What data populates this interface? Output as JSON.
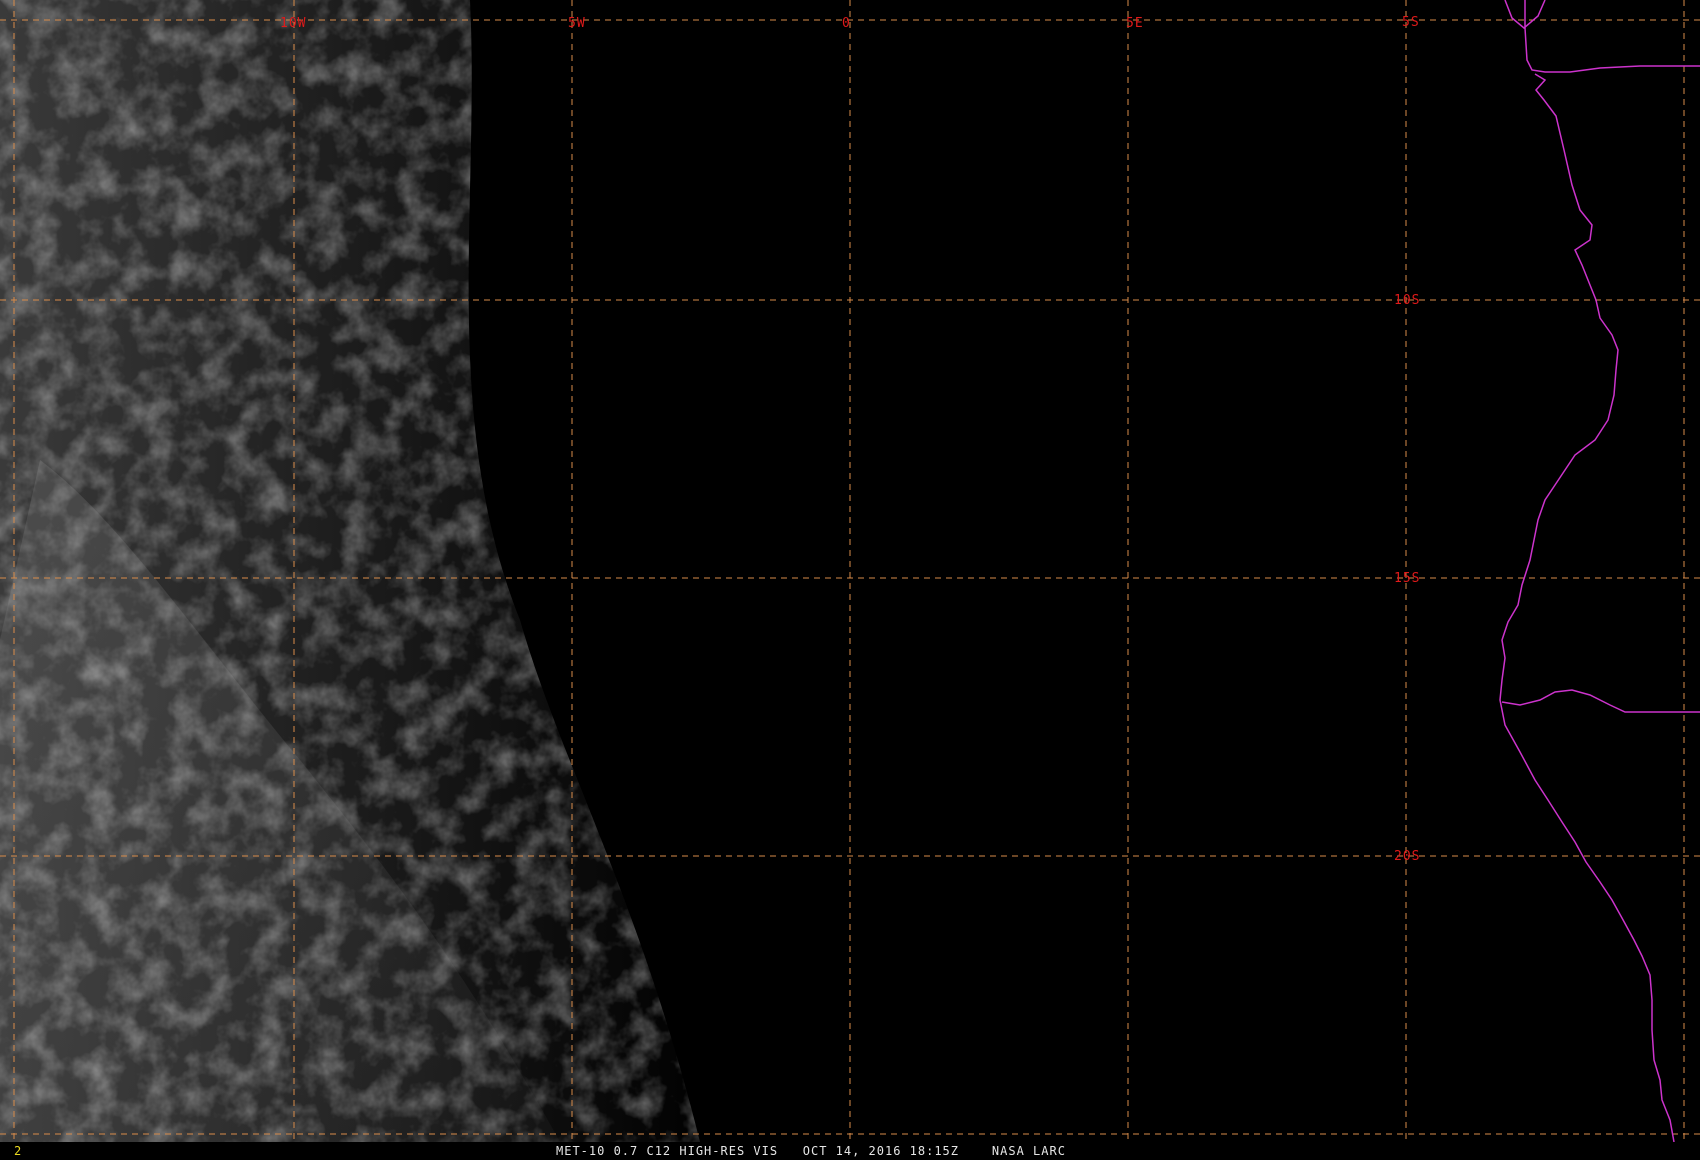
{
  "colors": {
    "background": "#000000",
    "grid_line": "#d98c4a",
    "grid_label": "#e01a1a",
    "coastline": "#cc33cc",
    "caption_text": "#e6e6e6",
    "frame_number": "#e8d820"
  },
  "grid": {
    "longitude_labels": [
      "10W",
      "5W",
      "0",
      "5E"
    ],
    "latitude_labels": [
      "5S",
      "10S",
      "15S",
      "20S"
    ]
  },
  "status_bar": {
    "frame_number": "2",
    "caption": "MET-10 0.7 C12 HIGH-RES VIS   OCT 14, 2016 18:15Z    NASA LARC"
  }
}
